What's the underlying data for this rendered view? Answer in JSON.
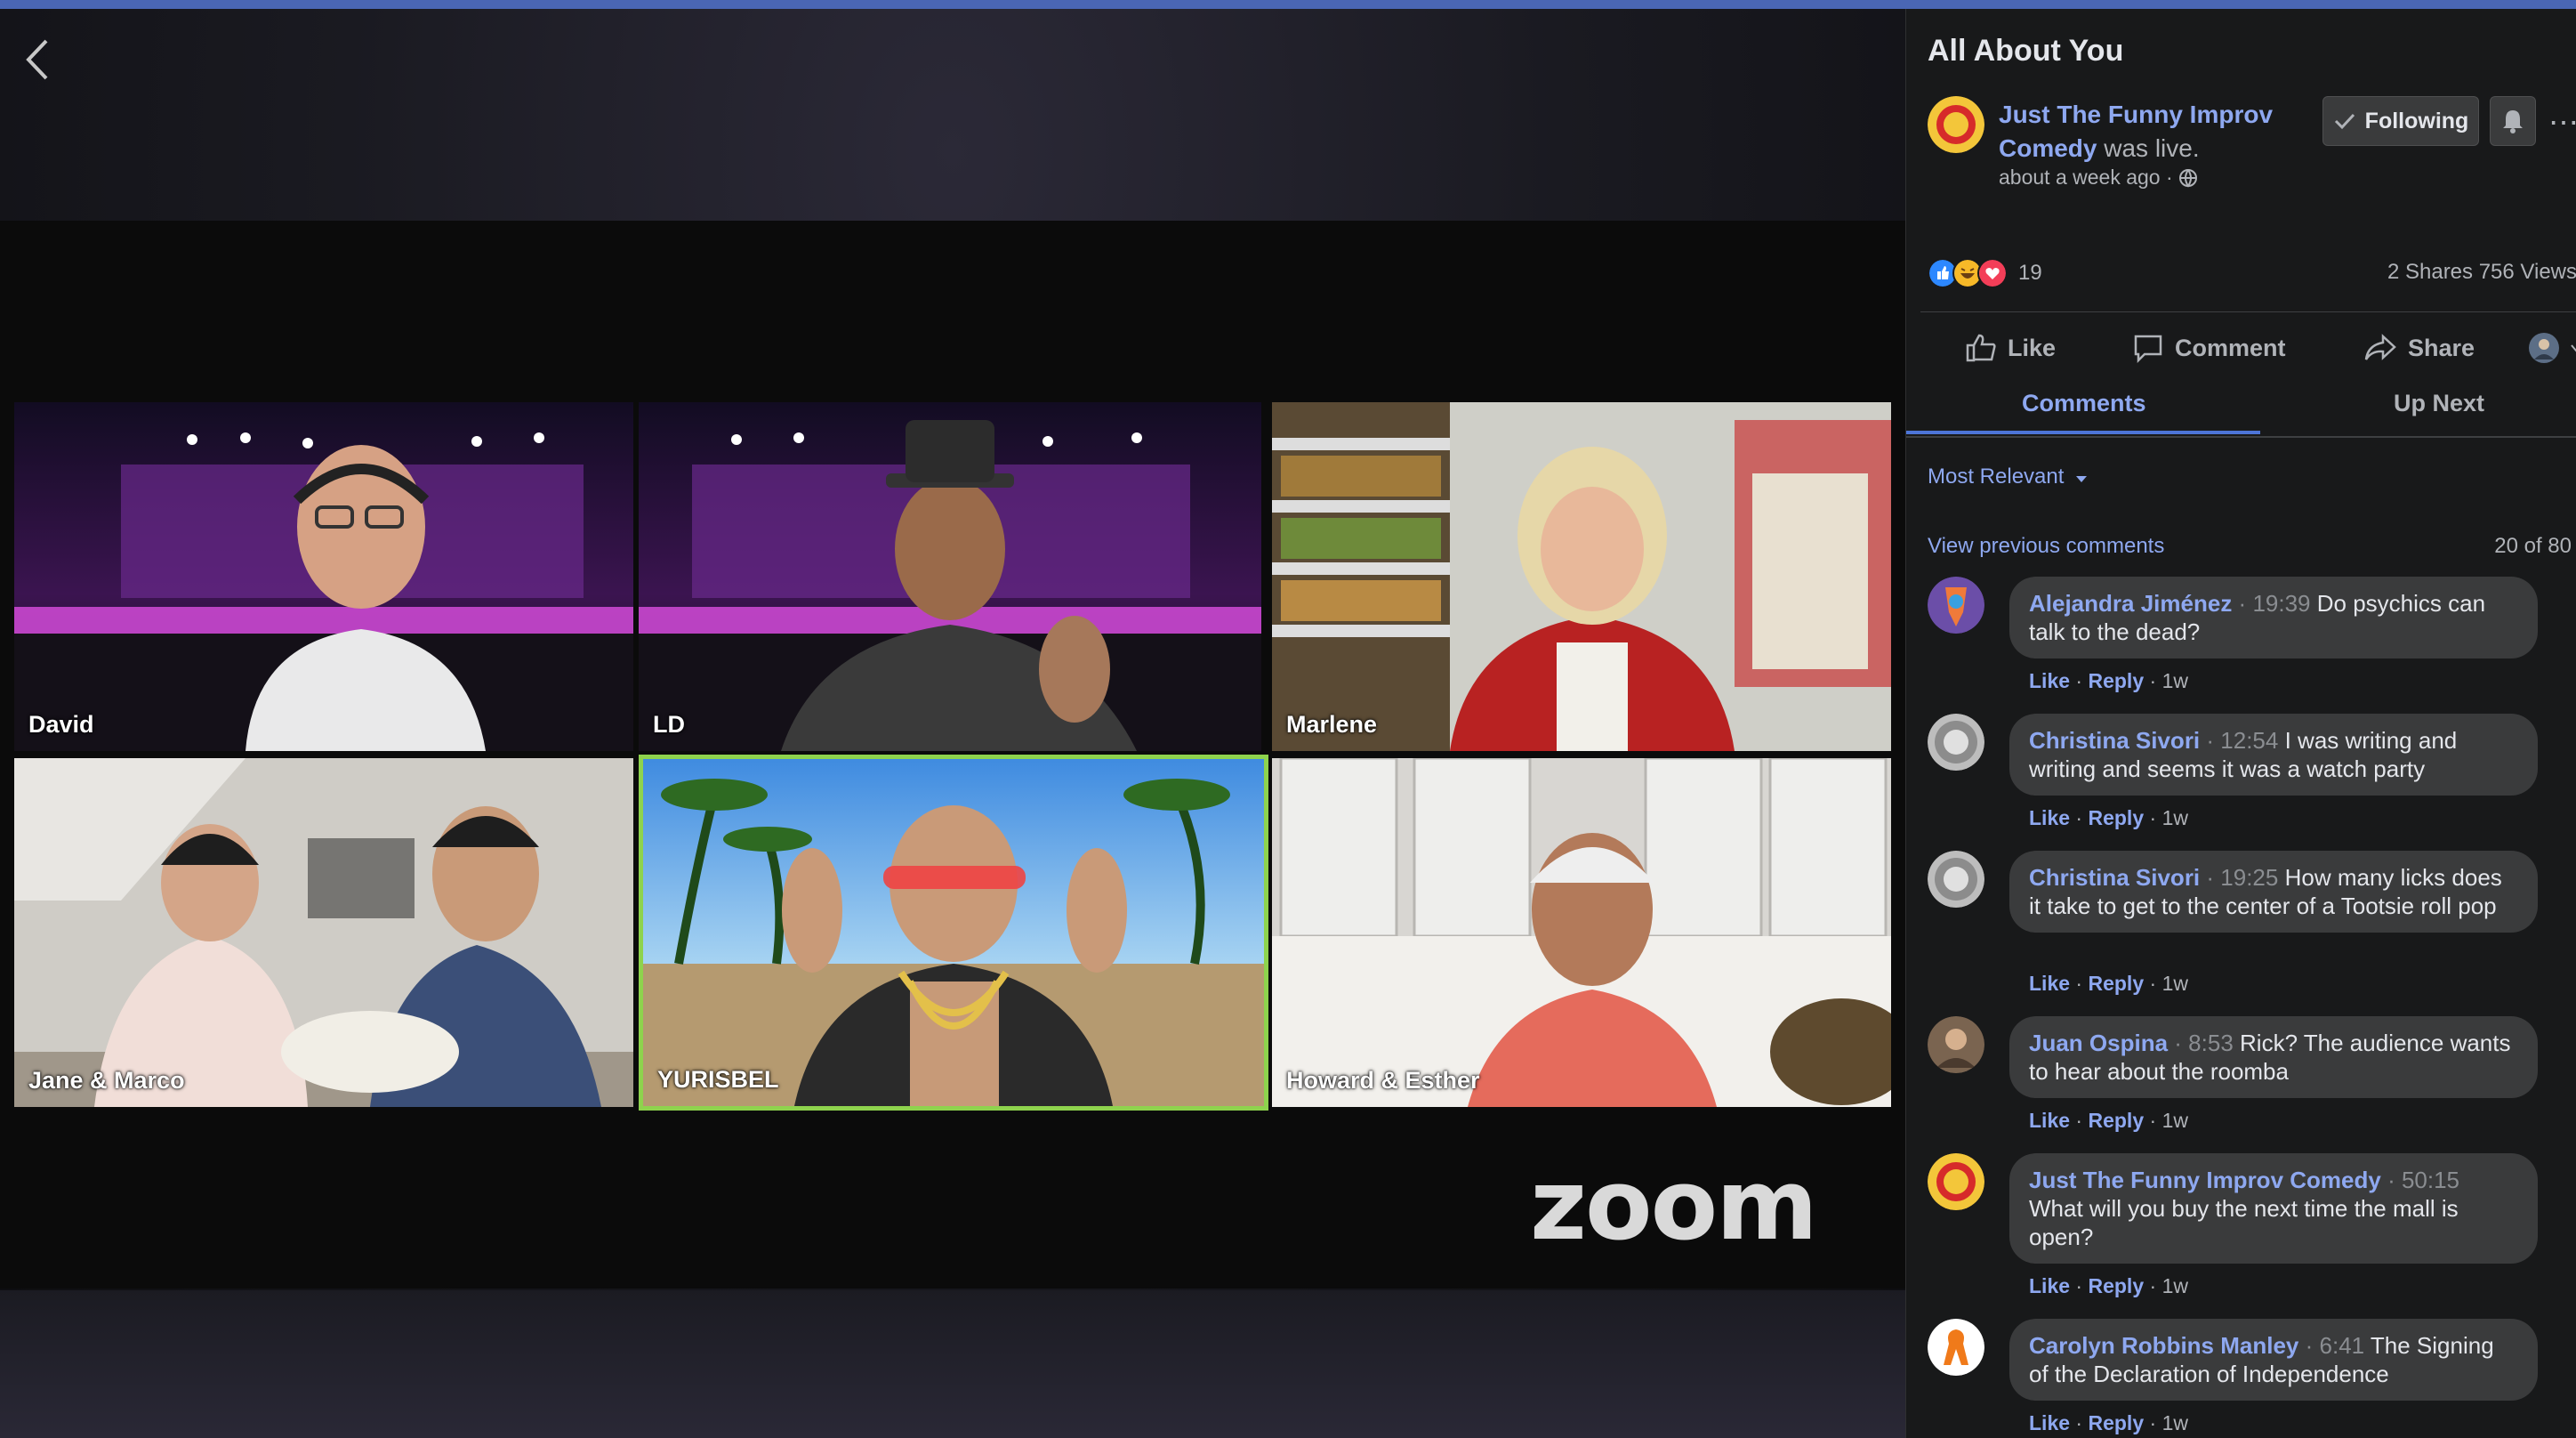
{
  "colors": {
    "accent": "#8ea8f0",
    "active_speaker_border": "#8ed34d",
    "top_strip": "#4a66b4",
    "panel_bg": "#18191a",
    "bubble_bg": "#3a3b3c"
  },
  "video": {
    "back_icon": "chevron-left-icon",
    "participants": [
      {
        "label": "David"
      },
      {
        "label": "LD"
      },
      {
        "label": "Marlene"
      },
      {
        "label": "Jane & Marco"
      },
      {
        "label": "YURISBEL"
      },
      {
        "label": "Howard & Esther"
      }
    ],
    "zoom_logo": "zoom"
  },
  "post": {
    "title": "All About You",
    "author": "Just The Funny Improv Comedy",
    "author_suffix": " was live.",
    "time": "about a week ago · ",
    "privacy_icon": "globe-icon",
    "following_label": "Following",
    "bell_icon": "bell-icon",
    "more_icon": "more-icon",
    "reaction_count": "19",
    "stats": "2 Shares  756 Views"
  },
  "actions": {
    "like": "Like",
    "comment": "Comment",
    "share": "Share"
  },
  "tabs": {
    "comments": "Comments",
    "up_next": "Up Next"
  },
  "comments_header": {
    "sort": "Most Relevant",
    "view_previous": "View previous comments",
    "count": "20 of 80"
  },
  "comments": [
    {
      "name": "Alejandra Jiménez",
      "time": "19:39",
      "text": "Do psychics can talk to the dead?",
      "like": "Like",
      "reply": "Reply",
      "age": "1w"
    },
    {
      "name": "Christina Sivori",
      "time": "12:54",
      "text": "I was writing and writing and seems it was a watch party",
      "like": "Like",
      "reply": "Reply",
      "age": "1w"
    },
    {
      "name": "Christina Sivori",
      "time": "19:25",
      "text": "How many licks does it take to get to the center of a Tootsie roll pop",
      "like": "Like",
      "reply": "Reply",
      "age": "1w"
    },
    {
      "name": "Juan Ospina",
      "time": "8:53",
      "text": "Rick? The audience wants to hear about the roomba",
      "like": "Like",
      "reply": "Reply",
      "age": "1w"
    },
    {
      "name": "Just The Funny Improv Comedy",
      "time": "50:15",
      "text": "What will you buy the next time the mall is open?",
      "like": "Like",
      "reply": "Reply",
      "age": "1w"
    },
    {
      "name": "Carolyn Robbins Manley",
      "time": "6:41",
      "text": "The Signing of the Declaration of Independence",
      "like": "Like",
      "reply": "Reply",
      "age": "1w"
    }
  ]
}
